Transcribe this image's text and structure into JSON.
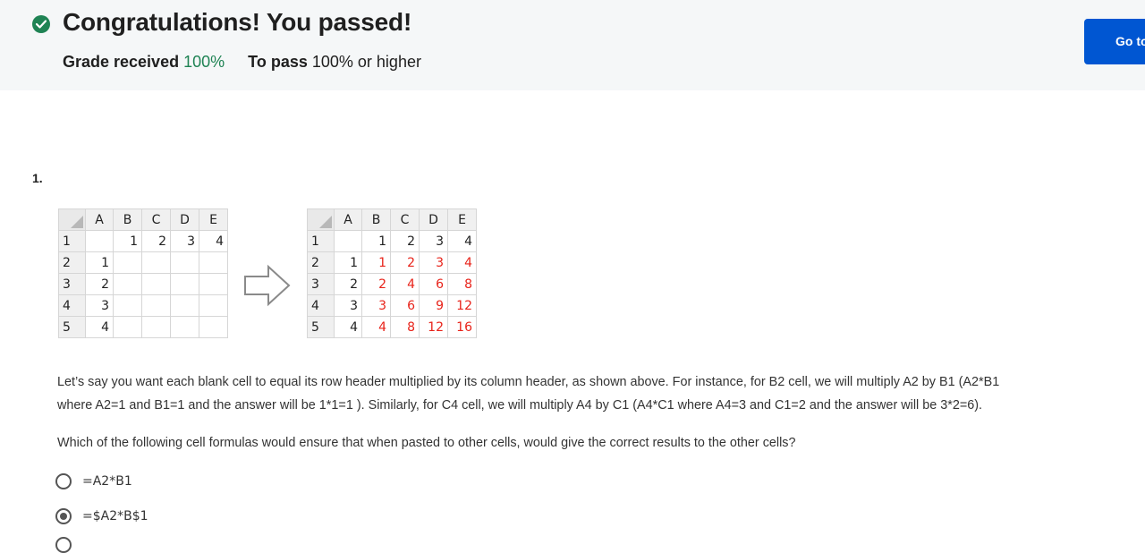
{
  "banner": {
    "title": "Congratulations! You passed!",
    "grade_label": "Grade received",
    "grade_value": "100%",
    "pass_label": "To pass",
    "pass_value": "100% or higher",
    "goto_label": "Go to next item"
  },
  "question": {
    "number": "1.",
    "left_sheet": {
      "columns": [
        "A",
        "B",
        "C",
        "D",
        "E"
      ],
      "rows": [
        {
          "hdr": "1",
          "cells": [
            "",
            "1",
            "2",
            "3",
            "4"
          ]
        },
        {
          "hdr": "2",
          "cells": [
            "1",
            "",
            "",
            "",
            ""
          ]
        },
        {
          "hdr": "3",
          "cells": [
            "2",
            "",
            "",
            "",
            ""
          ]
        },
        {
          "hdr": "4",
          "cells": [
            "3",
            "",
            "",
            "",
            ""
          ]
        },
        {
          "hdr": "5",
          "cells": [
            "4",
            "",
            "",
            "",
            ""
          ]
        }
      ]
    },
    "right_sheet": {
      "columns": [
        "A",
        "B",
        "C",
        "D",
        "E"
      ],
      "rows": [
        {
          "hdr": "1",
          "cells": [
            "",
            "1",
            "2",
            "3",
            "4"
          ]
        },
        {
          "hdr": "2",
          "cells": [
            "1",
            "1",
            "2",
            "3",
            "4"
          ]
        },
        {
          "hdr": "3",
          "cells": [
            "2",
            "2",
            "4",
            "6",
            "8"
          ]
        },
        {
          "hdr": "4",
          "cells": [
            "3",
            "3",
            "6",
            "9",
            "12"
          ]
        },
        {
          "hdr": "5",
          "cells": [
            "4",
            "4",
            "8",
            "12",
            "16"
          ]
        }
      ]
    },
    "paragraph1_line1": "Let’s say you want each blank cell to equal its row header multiplied by its column header, as shown above. For instance, for B2 cell, we will multiply A2 by B1 (A2*B1",
    "paragraph1_line2": "where A2=1 and B1=1 and the answer will be 1*1=1 ). Similarly, for C4 cell, we will multiply A4 by C1 (A4*C1 where A4=3 and C1=2 and the answer will be 3*2=6).",
    "paragraph2": "Which of the following cell formulas would ensure that when pasted to other cells, would give the correct results to the other cells?",
    "options": [
      {
        "label": "=A2*B1",
        "selected": false
      },
      {
        "label": "=$A2*B$1",
        "selected": true
      },
      {
        "label": "",
        "selected": false
      }
    ]
  },
  "colors": {
    "accent_green": "#1f8354",
    "button_blue": "#0056d2",
    "result_red": "#e8231a"
  }
}
